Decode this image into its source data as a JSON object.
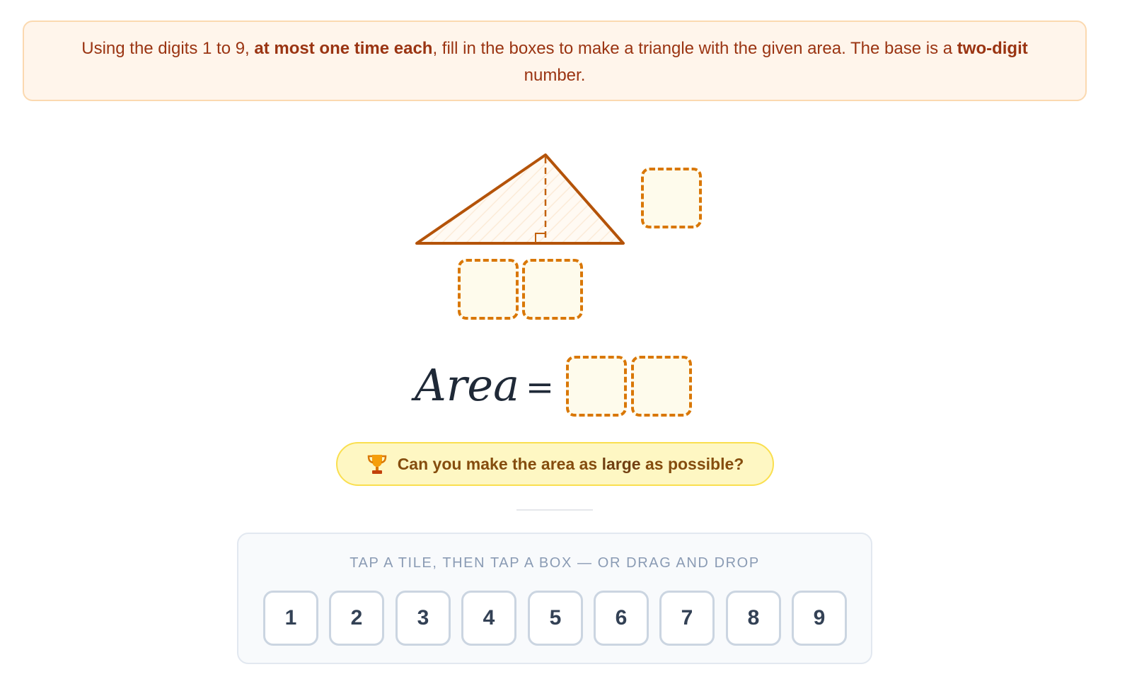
{
  "instructions": {
    "part1": "Using the digits 1 to 9, ",
    "bold1": "at most one time each",
    "part2": ", fill in the boxes to make a triangle with the given area. The base is a ",
    "bold2": "two-digit",
    "part3": " number."
  },
  "formula": {
    "area_label": "Area",
    "equals": "="
  },
  "challenge": {
    "icon": "trophy-icon",
    "prefix": "Can you make the area as ",
    "bold": "large",
    "suffix": " as possible?"
  },
  "tray": {
    "hint": "TAP A TILE, THEN TAP A BOX — OR DRAG AND DROP",
    "tiles": [
      "1",
      "2",
      "3",
      "4",
      "5",
      "6",
      "7",
      "8",
      "9"
    ]
  },
  "colors": {
    "accent": "#d97706",
    "triangle_stroke": "#b45309",
    "instruction_text": "#9a3412",
    "challenge_bg": "#fef7c3"
  }
}
